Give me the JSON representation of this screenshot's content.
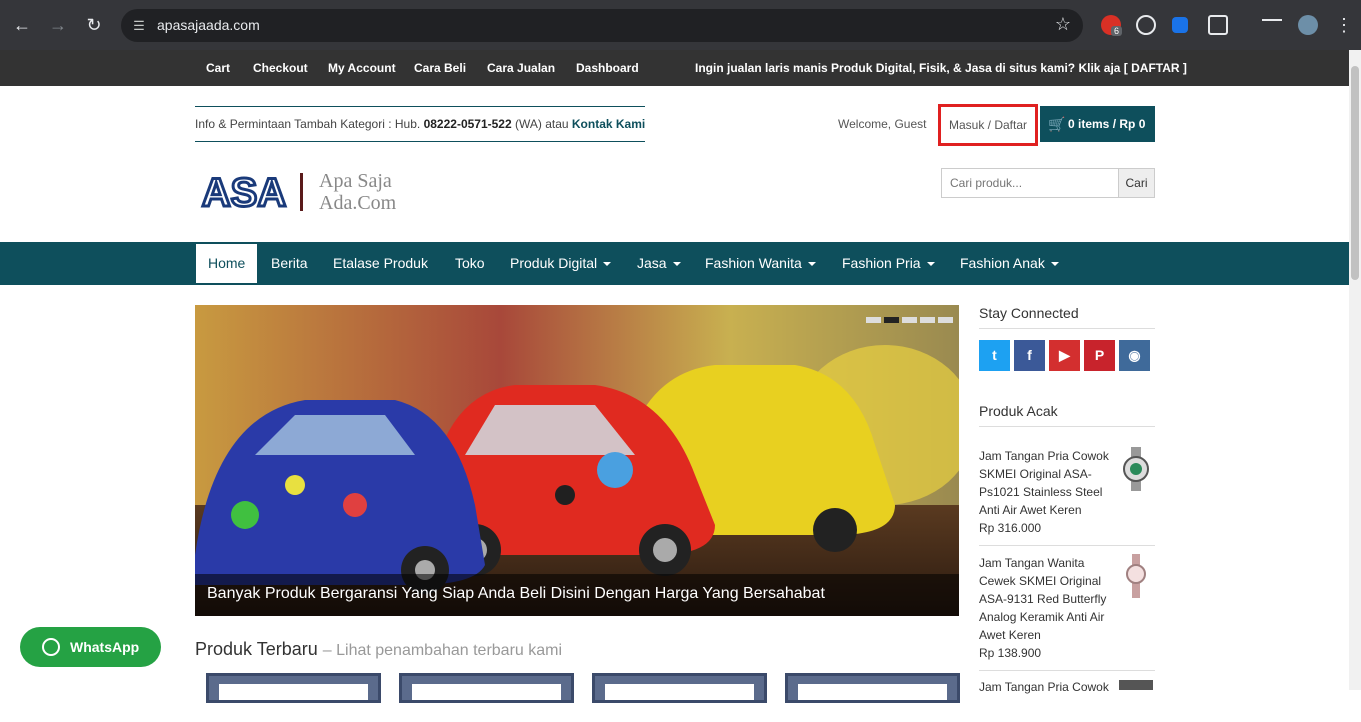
{
  "browser": {
    "url": "apasajaada.com",
    "ext_badge": "6"
  },
  "topbar": {
    "links": [
      "Cart",
      "Checkout",
      "My Account",
      "Cara Beli",
      "Cara Jualan",
      "Dashboard"
    ],
    "promo": "Ingin jualan laris manis Produk Digital, Fisik, & Jasa di situs kami? Klik aja [ DAFTAR ]"
  },
  "header": {
    "info_prefix": "Info & Permintaan Tambah Kategori : Hub. ",
    "phone": "08222-0571-522",
    "info_mid": " (WA) atau ",
    "contact_link": "Kontak Kami",
    "welcome": "Welcome, Guest",
    "login": "Masuk / Daftar",
    "cart": "0 items / Rp 0",
    "logo_mark": "ASA",
    "logo_line1": "Apa Saja",
    "logo_line2": "Ada.Com",
    "search_placeholder": "Cari produk...",
    "search_button": "Cari"
  },
  "nav": {
    "home": "Home",
    "berita": "Berita",
    "etalase": "Etalase Produk",
    "toko": "Toko",
    "digital": "Produk Digital",
    "jasa": "Jasa",
    "wanita": "Fashion Wanita",
    "pria": "Fashion Pria",
    "anak": "Fashion Anak"
  },
  "slider": {
    "caption": "Banyak Produk Bergaransi Yang Siap Anda Beli Disini Dengan Harga Yang Bersahabat"
  },
  "produk": {
    "title": "Produk Terbaru",
    "subtitle": "– Lihat penambahan terbaru kami"
  },
  "sidebar": {
    "stay_connected": "Stay Connected",
    "produk_acak": "Produk Acak",
    "products": [
      {
        "name": "Jam Tangan Pria Cowok SKMEI Original ASA-Ps1021 Stainless Steel Anti Air Awet Keren",
        "price": "Rp 316.000"
      },
      {
        "name": "Jam Tangan Wanita Cewek SKMEI Original ASA-9131 Red Butterfly Analog Keramik Anti Air Awet Keren",
        "price": "Rp 138.900"
      },
      {
        "name": "Jam Tangan Pria Cowok",
        "price": ""
      }
    ]
  },
  "whatsapp": "WhatsApp",
  "colors": {
    "primary": "#0e4f5c",
    "topbar": "#333333",
    "highlight": "#e02020",
    "whatsapp": "#25a244"
  }
}
